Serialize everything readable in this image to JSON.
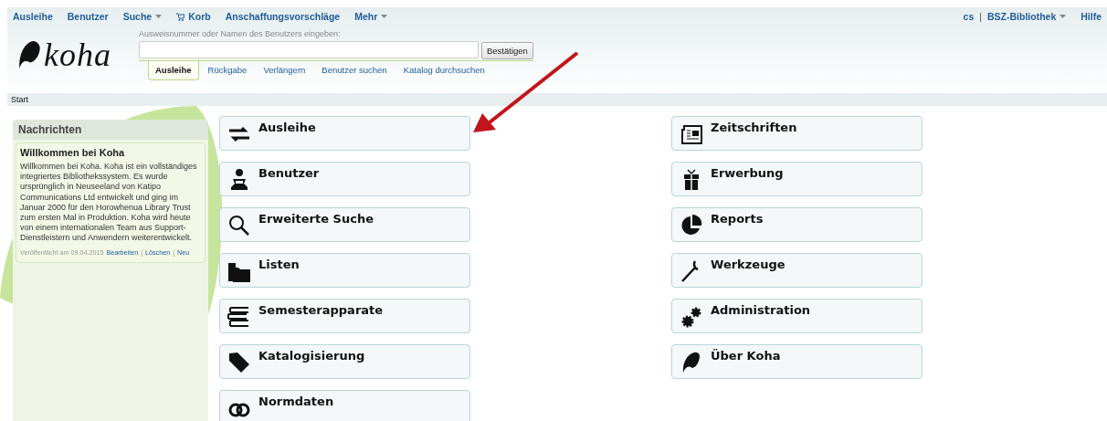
{
  "top_nav": {
    "left": [
      {
        "label": "Ausleihe",
        "kind": "link"
      },
      {
        "label": "Benutzer",
        "kind": "link"
      },
      {
        "label": "Suche",
        "kind": "menu"
      },
      {
        "label": "Korb",
        "kind": "cart"
      },
      {
        "label": "Anschaffungsvorschläge",
        "kind": "link"
      },
      {
        "label": "Mehr",
        "kind": "menu"
      }
    ],
    "right": [
      {
        "label": "cs",
        "kind": "link"
      },
      {
        "label": "|",
        "kind": "separator"
      },
      {
        "label": "BSZ-Bibliothek",
        "kind": "menu"
      },
      {
        "label": "Hilfe",
        "kind": "link"
      }
    ]
  },
  "logo": {
    "text": "koha"
  },
  "search": {
    "label": "Ausweisnummer oder Namen des Benutzers eingeben:",
    "button": "Bestätigen"
  },
  "search_tabs": [
    {
      "label": "Ausleihe",
      "selected": true
    },
    {
      "label": "Rückgabe",
      "selected": false
    },
    {
      "label": "Verlängern",
      "selected": false
    },
    {
      "label": "Benutzer suchen",
      "selected": false
    },
    {
      "label": "Katalog durchsuchen",
      "selected": false
    }
  ],
  "breadcrumb": [
    "Start"
  ],
  "news": {
    "title": "Nachrichten",
    "items": [
      {
        "title": "Willkommen bei Koha",
        "body": "Willkommen bei Koha. Koha ist ein vollständiges integriertes Bibliothekssystem. Es wurde ursprünglich in Neuseeland von Katipo Communications Ltd entwickelt und ging im Januar 2000 für den Horowhenua Library Trust zum ersten Mal in Produktion. Koha wird heute von einem internationalen Team aus Support-Dienstleistern und Anwendern weiterentwickelt.",
        "footer": [
          {
            "kind": "text",
            "label": "Veröffentlicht am 09.04.2015"
          },
          {
            "kind": "link",
            "label": "Bearbeiten"
          },
          {
            "kind": "separator",
            "label": "|"
          },
          {
            "kind": "link",
            "label": "Löschen"
          },
          {
            "kind": "separator",
            "label": "|"
          },
          {
            "kind": "link",
            "label": "Neu"
          }
        ]
      }
    ]
  },
  "modules": [
    [
      {
        "label": "Ausleihe",
        "kind": "circulation"
      },
      {
        "label": "Benutzer",
        "kind": "patrons"
      },
      {
        "label": "Erweiterte Suche",
        "kind": "search"
      },
      {
        "label": "Listen",
        "kind": "lists"
      },
      {
        "label": "Semesterapparate",
        "kind": "books"
      },
      {
        "label": "Katalogisierung",
        "kind": "tag"
      },
      {
        "label": "Normdaten",
        "kind": "link"
      }
    ],
    [
      {
        "label": "Zeitschriften",
        "kind": "serials"
      },
      {
        "label": "Erwerbung",
        "kind": "gift"
      },
      {
        "label": "Reports",
        "kind": "chart"
      },
      {
        "label": "Werkzeuge",
        "kind": "wrench"
      },
      {
        "label": "Administration",
        "kind": "gears"
      },
      {
        "label": "Über Koha",
        "kind": "koha"
      }
    ]
  ]
}
